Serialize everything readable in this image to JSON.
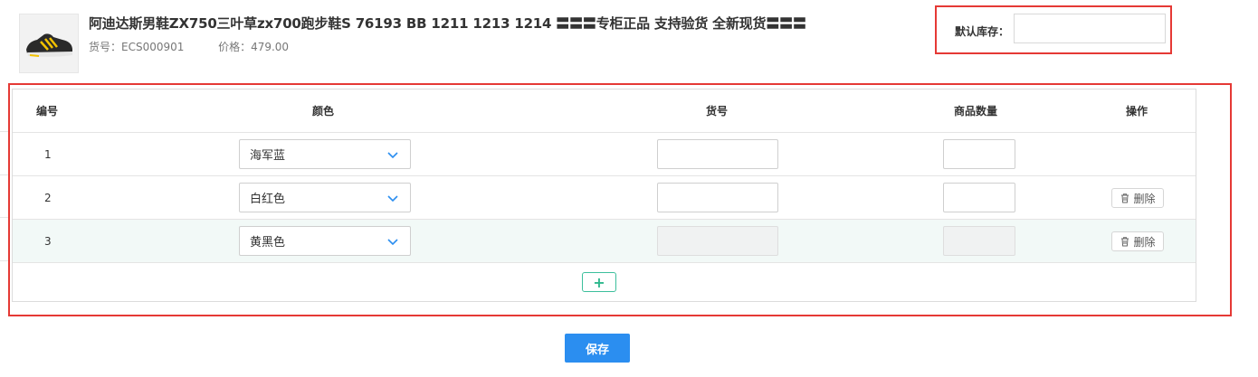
{
  "product": {
    "image_icon": "sneaker-thumbnail",
    "title": "阿迪达斯男鞋ZX750三叶草zx700跑步鞋S 76193 BB 1211 1213 1214 〓〓〓专柜正品 支持验货 全新现货〓〓〓",
    "sku_label": "货号：",
    "sku_value": "ECS000901",
    "price_label": "价格：",
    "price_value": "479.00"
  },
  "stock": {
    "label": "默认库存：",
    "value": "",
    "placeholder": ""
  },
  "table": {
    "headers": {
      "index": "编号",
      "color": "颜色",
      "sku": "货号",
      "quantity": "商品数量",
      "actions": "操作"
    },
    "rows": [
      {
        "index": "1",
        "color": "海军蓝",
        "sku": "",
        "quantity": "",
        "delete_label": "",
        "disabled": false
      },
      {
        "index": "2",
        "color": "白红色",
        "sku": "",
        "quantity": "",
        "delete_label": "删除",
        "disabled": false
      },
      {
        "index": "3",
        "color": "黄黑色",
        "sku": "",
        "quantity": "",
        "delete_label": "删除",
        "disabled": true
      }
    ],
    "add_label": "+"
  },
  "footer": {
    "save_label": "保存"
  },
  "colors": {
    "highlight": "#e53935",
    "primary": "#2b8ef0",
    "add_accent": "#2eb88d",
    "alt_row": "#f2f9f7"
  }
}
